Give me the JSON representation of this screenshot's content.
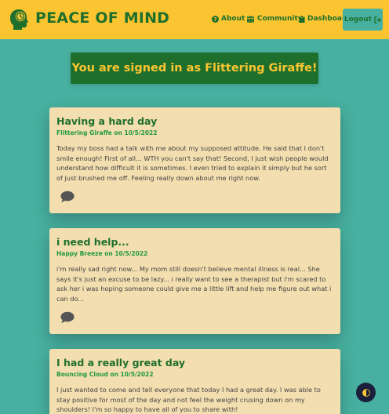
{
  "header": {
    "brand": "PEACE OF MIND",
    "nav": [
      {
        "label": "About",
        "icon": "question-circle-icon"
      },
      {
        "label": "Community",
        "icon": "community-icon"
      },
      {
        "label": "Dashboard",
        "icon": "clipboard-icon"
      }
    ],
    "logout_label": "Logout",
    "logout_icon": "sign-out-icon"
  },
  "banner": {
    "text": "You are signed in as Flittering Giraffe!"
  },
  "posts": [
    {
      "title": "Having a hard day",
      "meta": "Flittering Giraffe on 10/5/2022",
      "body": "Today my boss had a talk with me about my supposed attitude. He said that I don't smile enough! First of all... WTH you can't say that! Second, I just wish people would understand how difficult it is sometimes. I even tried to explain it simply but he sort of just brushed me off. Feeling really down about me right now."
    },
    {
      "title": "i need help...",
      "meta": "Happy Breeze on 10/5/2022",
      "body": "i'm really sad right now... My mom still doesn't believe mental illness is real... She says it's just an excuse to be lazy... i really want to see a therapist but i'm scared to ask her i was hoping someone could give me a little lift and help me figure out what i can do..."
    },
    {
      "title": "I had a really great day",
      "meta": "Bouncing Cloud on 10/5/2022",
      "body": "I just wanted to come and tell everyone that today I had a great day. I was able to stay positive for most of the day and not feel the weight crusing down on my shoulders! I'm so happy to have all of you to share with!"
    }
  ],
  "colors": {
    "background": "#48b0a0",
    "header": "#fbc531",
    "brand_green": "#1f6f2c",
    "card": "#f3deb0",
    "toggle": "#1a1f3c"
  }
}
